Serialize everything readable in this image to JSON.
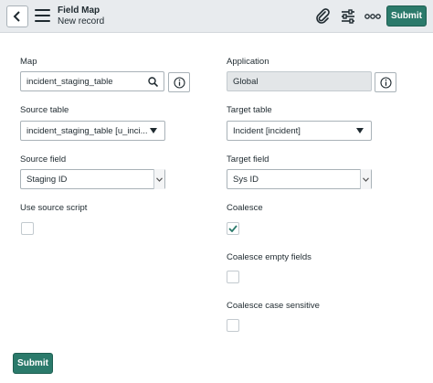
{
  "header": {
    "title": "Field Map",
    "subtitle": "New record",
    "submit_label": "Submit",
    "icons": [
      "back-icon",
      "menu-icon",
      "paperclip-icon",
      "sliders-icon",
      "more-icon"
    ]
  },
  "form": {
    "map": {
      "label": "Map",
      "value": "incident_staging_table"
    },
    "application": {
      "label": "Application",
      "value": "Global"
    },
    "source_table": {
      "label": "Source table",
      "value": "incident_staging_table [u_inci..."
    },
    "target_table": {
      "label": "Target table",
      "value": "Incident [incident]"
    },
    "source_field": {
      "label": "Source field",
      "value": "Staging ID"
    },
    "target_field": {
      "label": "Target field",
      "value": "Sys ID"
    },
    "use_source_script": {
      "label": "Use source script",
      "checked": false
    },
    "coalesce": {
      "label": "Coalesce",
      "checked": true
    },
    "coalesce_empty_fields": {
      "label": "Coalesce empty fields",
      "checked": false
    },
    "coalesce_case_sensitive": {
      "label": "Coalesce case sensitive",
      "checked": false
    }
  },
  "footer": {
    "submit_label": "Submit"
  },
  "colors": {
    "accent": "#2b7a6b",
    "header_bg": "#e8ebee",
    "check": "#2b7a6b"
  }
}
